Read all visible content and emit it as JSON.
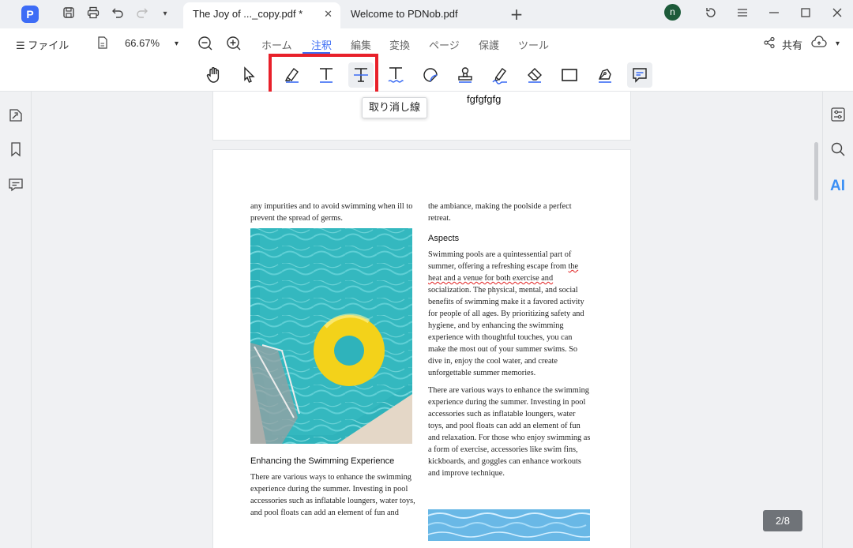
{
  "titlebar": {
    "app_logo": "P",
    "tabs": [
      {
        "label": "The Joy of ..._copy.pdf *",
        "close": "✕"
      },
      {
        "label": "Welcome to PDNob.pdf"
      }
    ],
    "new_tab": "+",
    "avatar": "n"
  },
  "menubar": {
    "file_label": "☰ ファイル",
    "zoom": "66.67%",
    "tabs": [
      "ホーム",
      "注釈",
      "編集",
      "変換",
      "ページ",
      "保護",
      "ツール"
    ],
    "active_tab": "注釈",
    "share_label": "共有"
  },
  "tooltip": "取り消し線",
  "accent_color": "#3b6cf4",
  "highlight_color": "#e8202a",
  "page1_text": "fgfgfgfg",
  "document": {
    "left_top": "any impurities and to avoid swimming when ill to prevent the spread of germs.",
    "heading_left": "Enhancing the Swimming Experience",
    "left_bottom": "There are various ways to enhance the swimming experience during the summer. Investing in pool accessories such as inflatable loungers, water toys, and pool floats can add an element of fun and",
    "right_top": "the ambiance, making the poolside a perfect retreat.",
    "heading_right": "Aspects",
    "right_p1_a": "Swimming pools are a quintessential part of summer, offering a refreshing escape from ",
    "right_p1_squiggle": "the heat and a venue for both exercise and",
    "right_p1_b": " socialization. The physical, mental, and social benefits of swimming make it a favored activity for people of all ages. By prioritizing safety and hygiene, and by enhancing the swimming experience with thoughtful touches, you can make the most out of your summer swims. So dive in, enjoy the cool water, and create unforgettable summer memories.",
    "right_p2": "There are various ways to enhance the swimming experience during the summer. Investing in pool accessories such as inflatable loungers, water toys, and pool floats can add an element of fun and relaxation. For those who enjoy swimming as a form of exercise, accessories like swim fins, kickboards, and goggles can enhance workouts and improve technique."
  },
  "page_indicator": "2/8",
  "icons": {
    "tools": [
      "hand-icon",
      "select-arrow-icon",
      "highlight-icon",
      "underline-icon",
      "strikethrough-icon",
      "squiggly-icon",
      "sticky-note-icon",
      "stamp-icon",
      "signature-icon",
      "eraser-icon",
      "rectangle-icon",
      "pen-icon",
      "comment-icon"
    ],
    "left": [
      "thumbnail-icon",
      "bookmark-icon",
      "comment-list-icon"
    ],
    "right": [
      "properties-icon",
      "search-icon",
      "ai-icon"
    ]
  }
}
